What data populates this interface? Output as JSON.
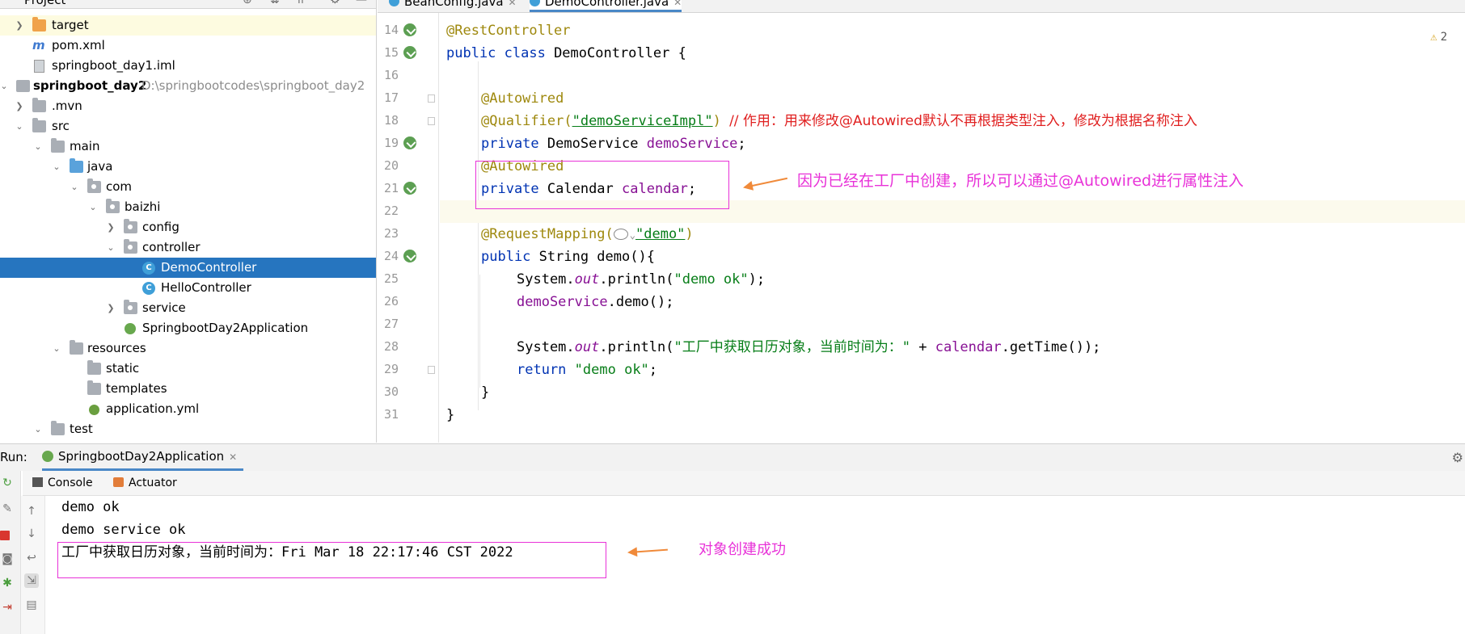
{
  "project": {
    "title": "Project",
    "items": [
      {
        "label": "target",
        "path": "",
        "bold": false
      },
      {
        "label": "pom.xml",
        "path": "",
        "bold": false
      },
      {
        "label": "springboot_day1.iml",
        "path": "",
        "bold": false
      },
      {
        "label": "springboot_day2",
        "path": "D:\\springbootcodes\\springboot_day2",
        "bold": true
      },
      {
        "label": ".mvn",
        "path": "",
        "bold": false
      },
      {
        "label": "src",
        "path": "",
        "bold": false
      },
      {
        "label": "main",
        "path": "",
        "bold": false
      },
      {
        "label": "java",
        "path": "",
        "bold": false
      },
      {
        "label": "com",
        "path": "",
        "bold": false
      },
      {
        "label": "baizhi",
        "path": "",
        "bold": false
      },
      {
        "label": "config",
        "path": "",
        "bold": false
      },
      {
        "label": "controller",
        "path": "",
        "bold": false
      },
      {
        "label": "DemoController",
        "path": "",
        "bold": false
      },
      {
        "label": "HelloController",
        "path": "",
        "bold": false
      },
      {
        "label": "service",
        "path": "",
        "bold": false
      },
      {
        "label": "SpringbootDay2Application",
        "path": "",
        "bold": false
      },
      {
        "label": "resources",
        "path": "",
        "bold": false
      },
      {
        "label": "static",
        "path": "",
        "bold": false
      },
      {
        "label": "templates",
        "path": "",
        "bold": false
      },
      {
        "label": "application.yml",
        "path": "",
        "bold": false
      },
      {
        "label": "test",
        "path": "",
        "bold": false
      }
    ]
  },
  "editor": {
    "tabs": [
      "BeanConfig.java",
      "DemoController.java"
    ],
    "warning_count": "2",
    "line_numbers": [
      "14",
      "15",
      "16",
      "17",
      "18",
      "19",
      "20",
      "21",
      "22",
      "23",
      "24",
      "25",
      "26",
      "27",
      "28",
      "29",
      "30",
      "31"
    ],
    "code": {
      "l14": "@RestController",
      "l15a": "public class",
      "l15b": " DemoController {",
      "l17": "@Autowired",
      "l18a": "@Qualifier(",
      "l18b": "\"demoServiceImpl\"",
      "l18c": ") ",
      "l18d": "// 作用：用来修改@Autowired默认不再根据类型注入，修改为根据名称注入",
      "l19a": "private",
      "l19b": " DemoService ",
      "l19c": "demoService",
      "l19d": ";",
      "l20": "@Autowired",
      "l21a": "private",
      "l21b": " Calendar ",
      "l21c": "calendar",
      "l21d": ";",
      "l23a": "@RequestMapping(",
      "l23b": "\"demo\"",
      "l23c": ")",
      "l24a": "public",
      "l24b": " String demo(){",
      "l25a": "System.",
      "l25b": "out",
      "l25c": ".println(",
      "l25d": "\"demo ok\"",
      "l25e": ");",
      "l26a": "demoService",
      "l26b": ".demo();",
      "l28a": "System.",
      "l28b": "out",
      "l28c": ".println(",
      "l28d": "\"工厂中获取日历对象，当前时间为：\"",
      "l28e": " + ",
      "l28f": "calendar",
      "l28g": ".getTime());",
      "l29a": "return",
      "l29b": "\"demo ok\"",
      "l29c": ";",
      "l30": "}",
      "l31": "}"
    },
    "annotation_text": "因为已经在工厂中创建，所以可以通过@Autowired进行属性注入"
  },
  "run": {
    "label": "Run:",
    "config_tab": "SpringbootDay2Application",
    "sub_tabs": [
      "Console",
      "Actuator"
    ],
    "output": [
      "demo ok",
      "demo service ok",
      "工厂中获取日历对象，当前时间为：Fri Mar 18 22:17:46 CST 2022"
    ],
    "annotation_text": "对象创建成功"
  },
  "colors": {
    "annotation_pink": "#e832d8",
    "annotation_arrow": "#f08a3a",
    "selection_blue": "#2675bf"
  }
}
